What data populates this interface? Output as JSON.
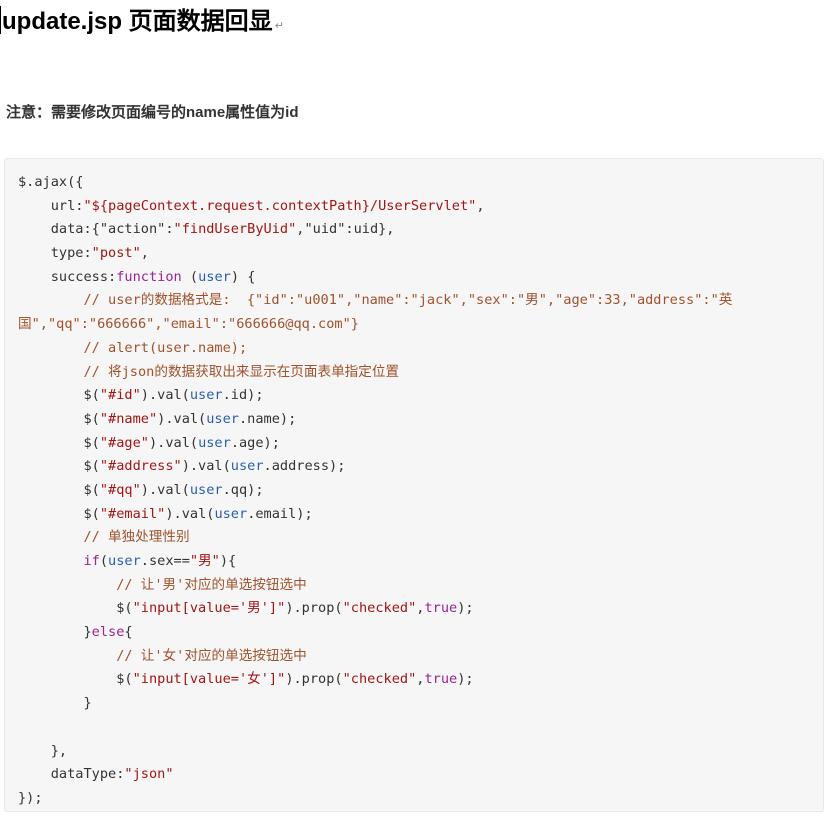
{
  "document": {
    "heading": "update.jsp 页面数据回显",
    "paragraph_mark": "↵",
    "note": "注意：需要修改页面编号的name属性值为id"
  },
  "code": {
    "lines": [
      [
        {
          "t": "$.ajax({",
          "c": "plain"
        }
      ],
      [
        {
          "t": "    url:",
          "c": "plain"
        },
        {
          "t": "\"${pageContext.request.contextPath}/UserServlet\"",
          "c": "str"
        },
        {
          "t": ",",
          "c": "plain"
        }
      ],
      [
        {
          "t": "    data:{",
          "c": "plain"
        },
        {
          "t": "\"action\"",
          "c": "plain"
        },
        {
          "t": ":",
          "c": "plain"
        },
        {
          "t": "\"findUserByUid\"",
          "c": "str"
        },
        {
          "t": ",",
          "c": "plain"
        },
        {
          "t": "\"uid\"",
          "c": "plain"
        },
        {
          "t": ":uid},",
          "c": "plain"
        }
      ],
      [
        {
          "t": "    type:",
          "c": "plain"
        },
        {
          "t": "\"post\"",
          "c": "str"
        },
        {
          "t": ",",
          "c": "plain"
        }
      ],
      [
        {
          "t": "    success:",
          "c": "plain"
        },
        {
          "t": "function",
          "c": "kw"
        },
        {
          "t": " (",
          "c": "plain"
        },
        {
          "t": "user",
          "c": "var"
        },
        {
          "t": ") {",
          "c": "plain"
        }
      ],
      [
        {
          "t": "        // user的数据格式是:  {\"id\":\"u001\",\"name\":\"jack\",\"sex\":\"男\",\"age\":33,\"address\":\"英",
          "c": "cm"
        }
      ],
      [
        {
          "t": "国\",\"qq\":\"666666\",\"email\":\"666666@qq.com\"}",
          "c": "cm"
        }
      ],
      [
        {
          "t": "        // alert(user.name);",
          "c": "cm"
        }
      ],
      [
        {
          "t": "        // 将json的数据获取出来显示在页面表单指定位置",
          "c": "cm"
        }
      ],
      [
        {
          "t": "        $(",
          "c": "plain"
        },
        {
          "t": "\"#id\"",
          "c": "str"
        },
        {
          "t": ").val(",
          "c": "plain"
        },
        {
          "t": "user",
          "c": "var"
        },
        {
          "t": ".id);",
          "c": "plain"
        }
      ],
      [
        {
          "t": "        $(",
          "c": "plain"
        },
        {
          "t": "\"#name\"",
          "c": "str"
        },
        {
          "t": ").val(",
          "c": "plain"
        },
        {
          "t": "user",
          "c": "var"
        },
        {
          "t": ".name);",
          "c": "plain"
        }
      ],
      [
        {
          "t": "        $(",
          "c": "plain"
        },
        {
          "t": "\"#age\"",
          "c": "str"
        },
        {
          "t": ").val(",
          "c": "plain"
        },
        {
          "t": "user",
          "c": "var"
        },
        {
          "t": ".age);",
          "c": "plain"
        }
      ],
      [
        {
          "t": "        $(",
          "c": "plain"
        },
        {
          "t": "\"#address\"",
          "c": "str"
        },
        {
          "t": ").val(",
          "c": "plain"
        },
        {
          "t": "user",
          "c": "var"
        },
        {
          "t": ".address);",
          "c": "plain"
        }
      ],
      [
        {
          "t": "        $(",
          "c": "plain"
        },
        {
          "t": "\"#qq\"",
          "c": "str"
        },
        {
          "t": ").val(",
          "c": "plain"
        },
        {
          "t": "user",
          "c": "var"
        },
        {
          "t": ".qq);",
          "c": "plain"
        }
      ],
      [
        {
          "t": "        $(",
          "c": "plain"
        },
        {
          "t": "\"#email\"",
          "c": "str"
        },
        {
          "t": ").val(",
          "c": "plain"
        },
        {
          "t": "user",
          "c": "var"
        },
        {
          "t": ".email);",
          "c": "plain"
        }
      ],
      [
        {
          "t": "        // 单独处理性别",
          "c": "cm"
        }
      ],
      [
        {
          "t": "        ",
          "c": "plain"
        },
        {
          "t": "if",
          "c": "kw"
        },
        {
          "t": "(",
          "c": "plain"
        },
        {
          "t": "user",
          "c": "var"
        },
        {
          "t": ".sex==",
          "c": "plain"
        },
        {
          "t": "\"男\"",
          "c": "str"
        },
        {
          "t": "){",
          "c": "plain"
        }
      ],
      [
        {
          "t": "            // 让'男'对应的单选按钮选中",
          "c": "cm"
        }
      ],
      [
        {
          "t": "            $(",
          "c": "plain"
        },
        {
          "t": "\"input[value='男']\"",
          "c": "str"
        },
        {
          "t": ").prop(",
          "c": "plain"
        },
        {
          "t": "\"checked\"",
          "c": "str"
        },
        {
          "t": ",",
          "c": "plain"
        },
        {
          "t": "true",
          "c": "kw"
        },
        {
          "t": ");",
          "c": "plain"
        }
      ],
      [
        {
          "t": "        }",
          "c": "plain"
        },
        {
          "t": "else",
          "c": "kw"
        },
        {
          "t": "{",
          "c": "plain"
        }
      ],
      [
        {
          "t": "            // 让'女'对应的单选按钮选中",
          "c": "cm"
        }
      ],
      [
        {
          "t": "            $(",
          "c": "plain"
        },
        {
          "t": "\"input[value='女']\"",
          "c": "str"
        },
        {
          "t": ").prop(",
          "c": "plain"
        },
        {
          "t": "\"checked\"",
          "c": "str"
        },
        {
          "t": ",",
          "c": "plain"
        },
        {
          "t": "true",
          "c": "kw"
        },
        {
          "t": ");",
          "c": "plain"
        }
      ],
      [
        {
          "t": "        }",
          "c": "plain"
        }
      ],
      [
        {
          "t": "",
          "c": "plain"
        }
      ],
      [
        {
          "t": "    },",
          "c": "plain"
        }
      ],
      [
        {
          "t": "    dataType:",
          "c": "plain"
        },
        {
          "t": "\"json\"",
          "c": "str"
        }
      ],
      [
        {
          "t": "});",
          "c": "plain"
        }
      ]
    ]
  },
  "colors": {
    "string": "#a31515",
    "keyword": "#9b2393",
    "comment": "#a0522d",
    "variable": "#2a5db0",
    "code_background": "#f6f6f6"
  }
}
